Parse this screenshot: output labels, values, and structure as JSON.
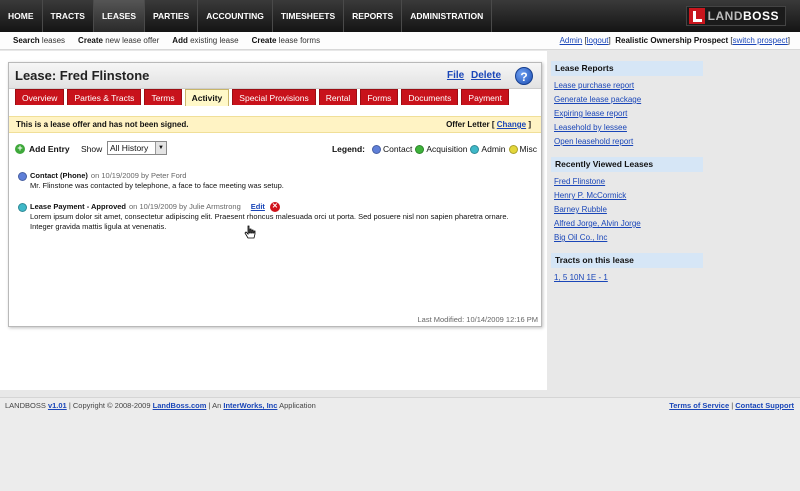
{
  "nav": {
    "items": [
      "HOME",
      "TRACTS",
      "LEASES",
      "PARTIES",
      "ACCOUNTING",
      "TIMESHEETS",
      "REPORTS",
      "ADMINISTRATION"
    ],
    "active": "LEASES",
    "logo_text_a": "LAND",
    "logo_text_b": "BOSS"
  },
  "subnav": {
    "items": [
      {
        "verb": "Search",
        "rest": "leases"
      },
      {
        "verb": "Create",
        "rest": "new lease offer"
      },
      {
        "verb": "Add",
        "rest": "existing lease"
      },
      {
        "verb": "Create",
        "rest": "lease forms"
      }
    ],
    "admin_link": "Admin",
    "logout_link": "logout",
    "company": "Realistic Ownership Prospect",
    "switch_link": "switch prospect"
  },
  "lease": {
    "title": "Lease: Fred Flinstone",
    "file_link": "File",
    "delete_link": "Delete",
    "help": "?",
    "tabs": [
      "Overview",
      "Parties & Tracts",
      "Terms",
      "Activity",
      "Special Provisions",
      "Rental",
      "Forms",
      "Documents",
      "Payment"
    ],
    "active_tab": "Activity",
    "offer_notice": "This is a lease offer and has not been signed.",
    "offer_letter_label": "Offer Letter",
    "change_link": "Change",
    "add_entry": "Add Entry",
    "show_label": "Show",
    "show_value": "All History",
    "legend_label": "Legend:",
    "legend": [
      {
        "label": "Contact",
        "color": "#5f7fd8"
      },
      {
        "label": "Acquisition",
        "color": "#3db23a"
      },
      {
        "label": "Admin",
        "color": "#3fb8c8"
      },
      {
        "label": "Misc",
        "color": "#e3d63a"
      }
    ],
    "entries": [
      {
        "title": "Contact (Phone)",
        "meta": "on 10/19/2009 by Peter Ford",
        "body": "Mr. Flinstone was contacted by telephone, a face to face meeting was setup.",
        "color": "#5f7fd8"
      },
      {
        "title": "Lease Payment - Approved",
        "meta": "on 10/19/2009 by Julie Armstrong",
        "edit": "Edit",
        "body": "Lorem ipsum dolor sit amet, consectetur adipiscing elit. Praesent rhoncus malesuada orci ut porta. Sed posuere nisl non sapien pharetra ornare. Integer gravida mattis ligula at venenatis.",
        "color": "#3fb8c8"
      }
    ],
    "last_modified": "Last Modified: 10/14/2009 12:16 PM"
  },
  "sidebar": {
    "reports_title": "Lease Reports",
    "reports": [
      "Lease purchase report",
      "Generate lease package",
      "Expiring lease report",
      "Leasehold by lessee",
      "Open leasehold report"
    ],
    "recent_title": "Recently Viewed Leases",
    "recent": [
      "Fred Flinstone",
      "Henry P. McCormick",
      "Barney Rubble",
      "Alfred Jorge, Alvin Jorge",
      "Big Oil Co., Inc"
    ],
    "tracts_title": "Tracts on this lease",
    "tracts": [
      "1, 5 10N 1E - 1"
    ]
  },
  "footer": {
    "brand": "LANDBOSS",
    "version": "v1.01",
    "copyright": "| Copyright © 2008-2009",
    "site_link": "LandBoss.com",
    "an_text": "| An",
    "company_link": "InterWorks, Inc",
    "app_text": "Application",
    "terms_link": "Terms of Service",
    "support_link": "Contact Support"
  }
}
